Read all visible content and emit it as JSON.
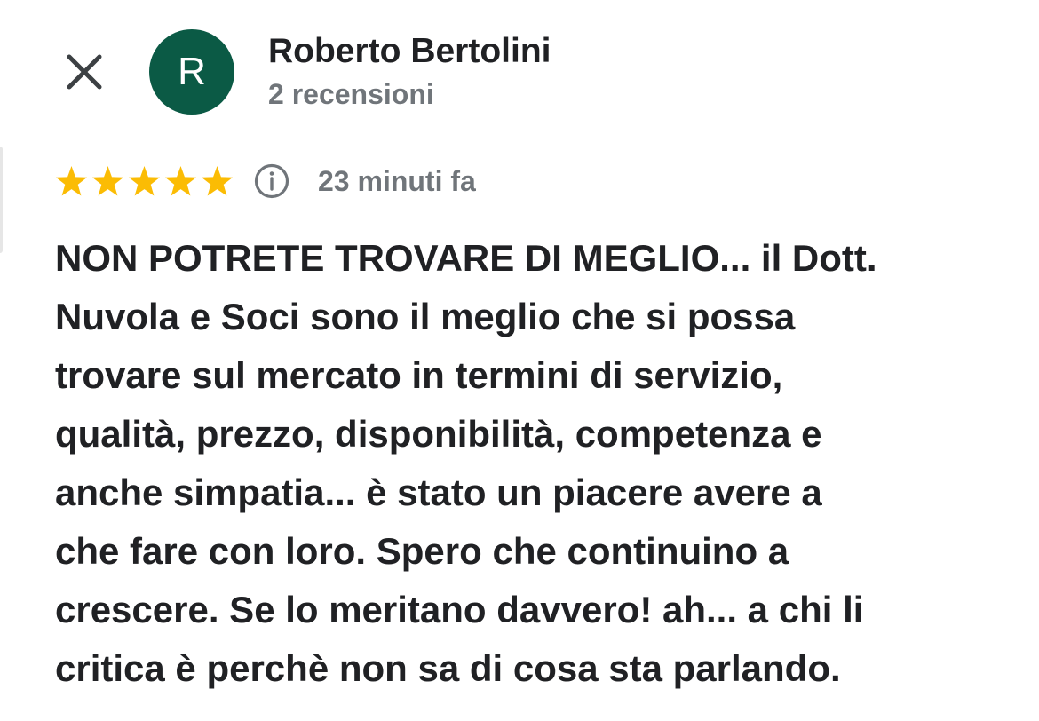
{
  "header": {
    "close_icon": "close-icon",
    "avatar_initial": "R",
    "avatar_color": "#0b5a45",
    "name": "Roberto Bertolini",
    "meta": "2 recensioni"
  },
  "rating": {
    "stars": 5,
    "max_stars": 5,
    "star_color": "#fbbc04",
    "info_icon": "info-icon",
    "time_ago": "23 minuti fa"
  },
  "review": {
    "lines": [
      "NON POTRETE TROVARE DI MEGLIO... il Dott.",
      "Nuvola e Soci sono il meglio che si possa",
      "trovare sul mercato in termini di servizio,",
      "qualità, prezzo, disponibilità, competenza e",
      "anche simpatia... è stato un piacere avere a",
      "che fare con loro. Spero che continuino a",
      "crescere. Se lo meritano davvero! ah... a chi li",
      "critica è perchè non sa di cosa sta parlando."
    ]
  }
}
